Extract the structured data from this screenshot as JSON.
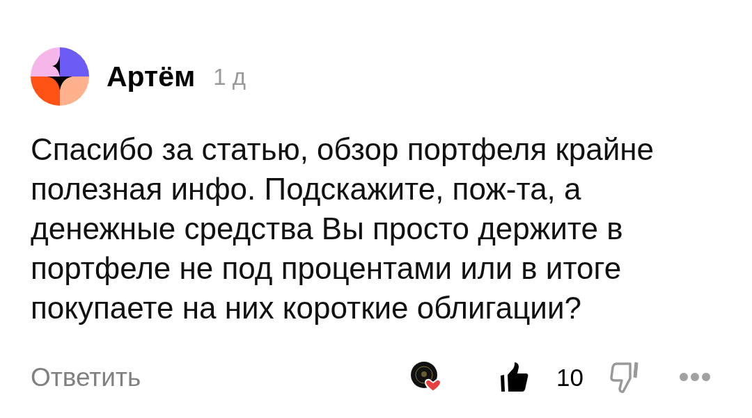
{
  "comment": {
    "author": {
      "name": "Артём"
    },
    "time": "1 д",
    "text": "Спасибо за статью, обзор портфеля крайне полезная инфо. Подскажите, пож-та, а денежные средства Вы просто держите в портфеле не под процентами или в итоге покупаете на них короткие облигации?"
  },
  "actions": {
    "reply": "Ответить",
    "liked": true,
    "like_count": "10",
    "disliked": false
  }
}
